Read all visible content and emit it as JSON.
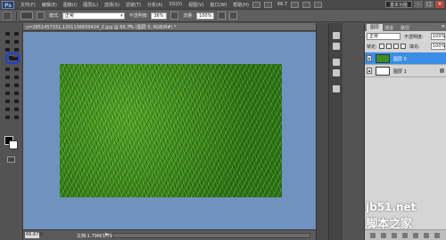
{
  "menubar": {
    "logo": "Ps",
    "items": [
      "文件(F)",
      "编辑(E)",
      "图像(I)",
      "图层(L)",
      "选择(S)",
      "滤镜(T)",
      "分析(A)",
      "3D(D)",
      "视图(V)",
      "窗口(W)",
      "帮助(H)"
    ],
    "zoom": "66.7",
    "workspace": "基本功能",
    "controls": [
      "–",
      "□",
      "×"
    ]
  },
  "options": {
    "mode_label": "模式:",
    "mode_value": "正常",
    "opacity_label": "不透明度:",
    "opacity_value": "36%",
    "flow_label": "流量:",
    "flow_value": "100%"
  },
  "document": {
    "tab_title": "u=2851457331,1201136659424_2.jpg @ 66.7% (图层 0, RGB/8#) *",
    "tab_close": "×",
    "zoom_field": "66.67%",
    "status": "文档:1.79M/1.79M",
    "status_arrow": "▶"
  },
  "layers": {
    "tab_layers": "图层",
    "tab_channels": "通道",
    "tab_paths": "路径",
    "menu_glyph": "≡",
    "blend_mode": "正常",
    "opacity_label": "不透明度:",
    "opacity_value": "100%",
    "lock_label": "锁定:",
    "fill_label": "填充:",
    "fill_value": "100%",
    "items": [
      {
        "name": "图层 0",
        "selected": true
      },
      {
        "name": "图层 1",
        "selected": false
      }
    ]
  },
  "watermark": {
    "site": "jb51.net",
    "cn": "脚本之家"
  }
}
